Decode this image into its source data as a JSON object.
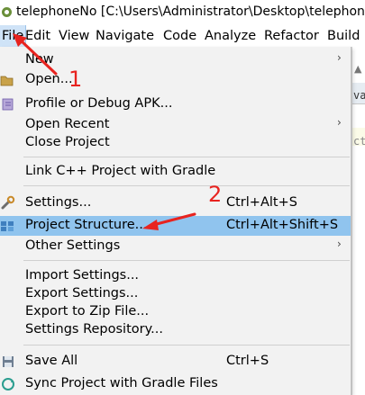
{
  "window": {
    "title": "telephoneNo [C:\\Users\\Administrator\\Desktop\\telephoneNo]"
  },
  "menubar": {
    "items": [
      "File",
      "Edit",
      "View",
      "Navigate",
      "Code",
      "Analyze",
      "Refactor",
      "Build"
    ]
  },
  "background": {
    "fragments": [
      "va",
      "ctc"
    ]
  },
  "file_menu": {
    "new": "New",
    "open": "Open...",
    "profile": "Profile or Debug APK...",
    "open_recent": "Open Recent",
    "close_project": "Close Project",
    "link_cpp": "Link C++ Project with Gradle",
    "settings": "Settings...",
    "settings_shortcut": "Ctrl+Alt+S",
    "project_structure": "Project Structure...",
    "project_structure_shortcut": "Ctrl+Alt+Shift+S",
    "other_settings": "Other Settings",
    "import_settings": "Import Settings...",
    "export_settings": "Export Settings...",
    "export_zip": "Export to Zip File...",
    "settings_repo": "Settings Repository...",
    "save_all": "Save All",
    "save_all_shortcut": "Ctrl+S",
    "sync_gradle": "Sync Project with Gradle Files"
  },
  "annotations": {
    "mark_1": "1",
    "mark_2": "2"
  },
  "colors": {
    "highlight": "#90c4ee",
    "menu_bg": "#f2f2f2",
    "annotation_red": "#e8231f"
  }
}
